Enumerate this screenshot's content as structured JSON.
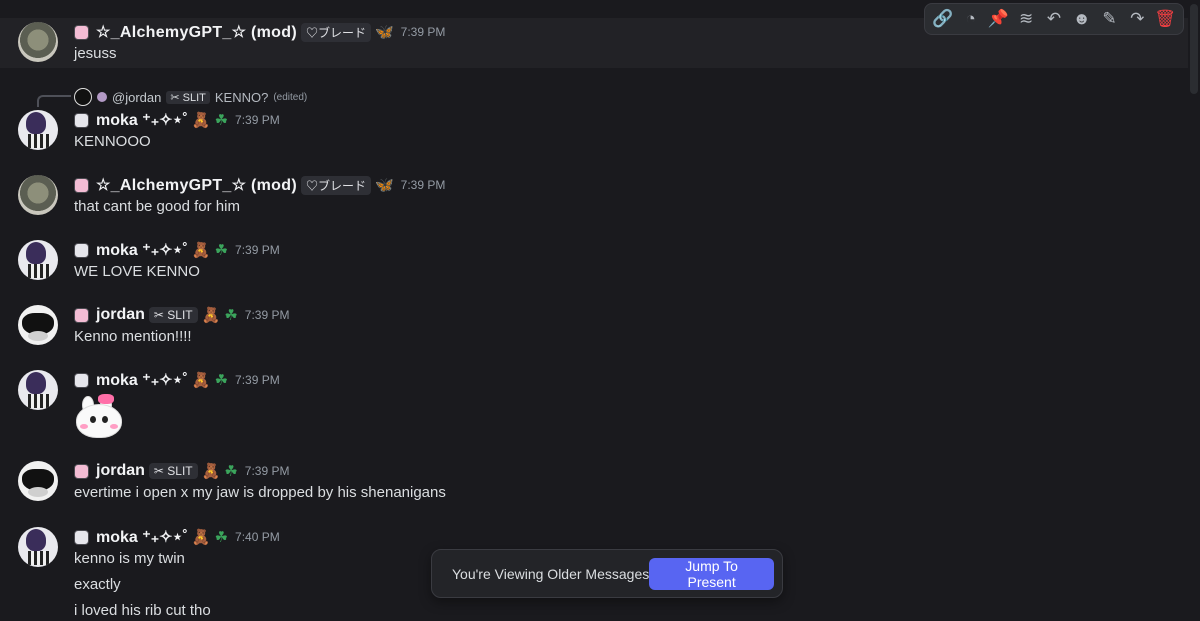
{
  "toolbar": {
    "icons": [
      "link-icon",
      "thread-icon",
      "pin-icon",
      "apps-icon",
      "reply-icon",
      "emoji-icon",
      "edit-icon",
      "forward-icon",
      "delete-icon"
    ]
  },
  "reply_preview": {
    "name": "@jordan",
    "tag": "✂ SLIT",
    "text": "KENNO?",
    "edited": "(edited)"
  },
  "messages": [
    {
      "name": "☆_AlchemyGPT_☆ (mod)",
      "tag": "♡ブレード",
      "time": "7:39 PM",
      "lines": [
        "jesuss"
      ]
    },
    {
      "name": "moka ⁺₊✧⋆˚",
      "time": "7:39 PM",
      "lines": [
        "KENNOOO"
      ]
    },
    {
      "name": "☆_AlchemyGPT_☆ (mod)",
      "tag": "♡ブレード",
      "time": "7:39 PM",
      "lines": [
        "that cant be good for him"
      ]
    },
    {
      "name": "moka ⁺₊✧⋆˚",
      "time": "7:39 PM",
      "lines": [
        "WE LOVE KENNO"
      ]
    },
    {
      "name": "jordan",
      "tag": "✂ SLIT",
      "time": "7:39 PM",
      "lines": [
        "Kenno mention!!!!"
      ]
    },
    {
      "name": "moka ⁺₊✧⋆˚",
      "time": "7:39 PM",
      "lines": []
    },
    {
      "name": "jordan",
      "tag": "✂ SLIT",
      "time": "7:39 PM",
      "lines": [
        "evertime i open x my jaw is dropped by his shenanigans"
      ]
    },
    {
      "name": "moka ⁺₊✧⋆˚",
      "time": "7:40 PM",
      "lines": [
        "kenno is my twin",
        "exactly",
        "i loved his rib cut tho"
      ]
    }
  ],
  "older_bar": {
    "text": "You're Viewing Older Messages",
    "button": "Jump To Present"
  },
  "colors": {
    "accent": "#5865f2",
    "background": "#1a1a1e",
    "danger": "#f23f42",
    "role_green": "#3ba55c"
  }
}
